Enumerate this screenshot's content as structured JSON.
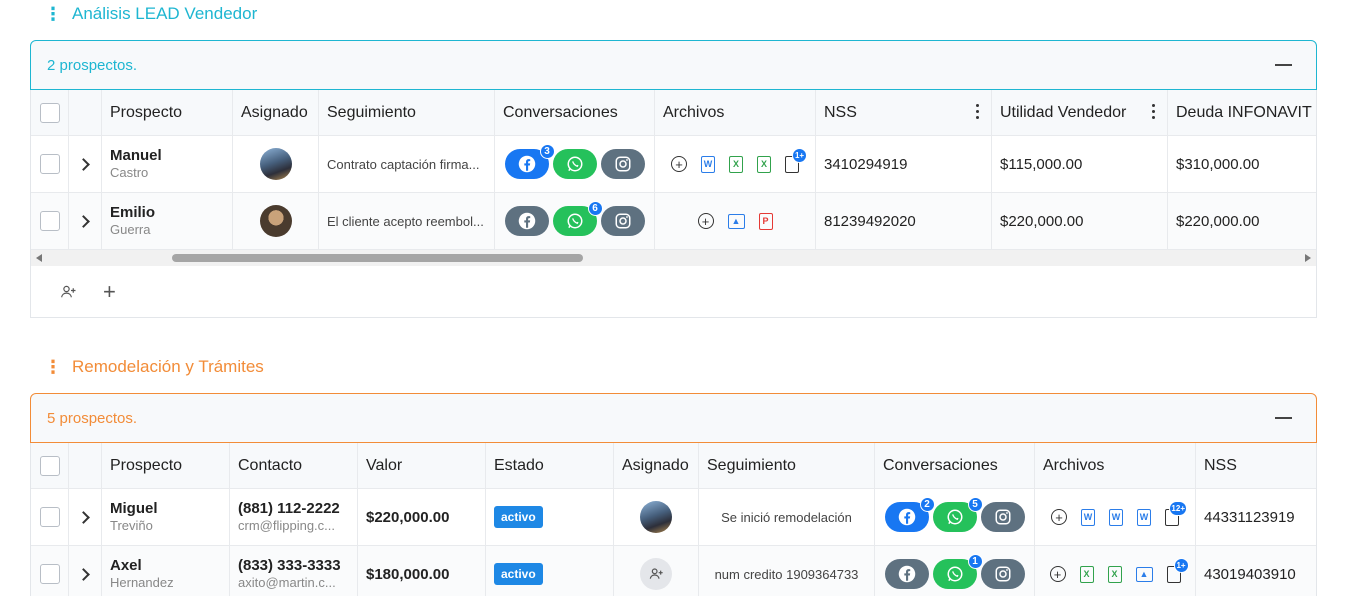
{
  "section1": {
    "title": "Análisis LEAD Vendedor",
    "count_text": "2 prospectos.",
    "headers": [
      "Prospecto",
      "Asignado",
      "Seguimiento",
      "Conversaciones",
      "Archivos",
      "NSS",
      "Utilidad Vendedor",
      "Deuda INFONAVIT"
    ],
    "rows": [
      {
        "first": "Manuel",
        "last": "Castro",
        "seguimiento": "Contrato captación firma...",
        "fb_badge": "3",
        "wa_badge": "",
        "file_badge": "1+",
        "nss": "3410294919",
        "utilidad": "$115,000.00",
        "deuda": "$310,000.00"
      },
      {
        "first": "Emilio",
        "last": "Guerra",
        "seguimiento": "El cliente acepto reembol...",
        "fb_badge": "",
        "wa_badge": "6",
        "file_badge": "",
        "nss": "81239492020",
        "utilidad": "$220,000.00",
        "deuda": "$220,000.00"
      }
    ]
  },
  "section2": {
    "title": "Remodelación y Trámites",
    "count_text": "5 prospectos.",
    "headers": [
      "Prospecto",
      "Contacto",
      "Valor",
      "Estado",
      "Asignado",
      "Seguimiento",
      "Conversaciones",
      "Archivos",
      "NSS"
    ],
    "rows": [
      {
        "first": "Miguel",
        "last": "Treviño",
        "phone": "(881) 112-2222",
        "email": "crm@flipping.c...",
        "valor": "$220,000.00",
        "estado": "activo",
        "seguimiento": "Se inició remodelación",
        "fb_badge": "2",
        "wa_badge": "5",
        "file_badge": "12+",
        "nss": "44331123919"
      },
      {
        "first": "Axel",
        "last": "Hernandez",
        "phone": "(833) 333-3333",
        "email": "axito@martin.c...",
        "valor": "$180,000.00",
        "estado": "activo",
        "seguimiento": "num credito 1909364733",
        "fb_badge": "",
        "wa_badge": "1",
        "file_badge": "1+",
        "nss": "43019403910"
      }
    ]
  },
  "icons": {
    "section_menu": "vertical-dots-icon",
    "collapse": "minus-icon",
    "add_user": "user-plus-icon",
    "add": "plus-icon",
    "colors": {
      "teal": "#1eb6d1",
      "orange": "#f28c38",
      "facebook": "#1877f2",
      "whatsapp": "#25c15b",
      "instagram": "#5e7180",
      "status": "#1e88e5"
    }
  }
}
